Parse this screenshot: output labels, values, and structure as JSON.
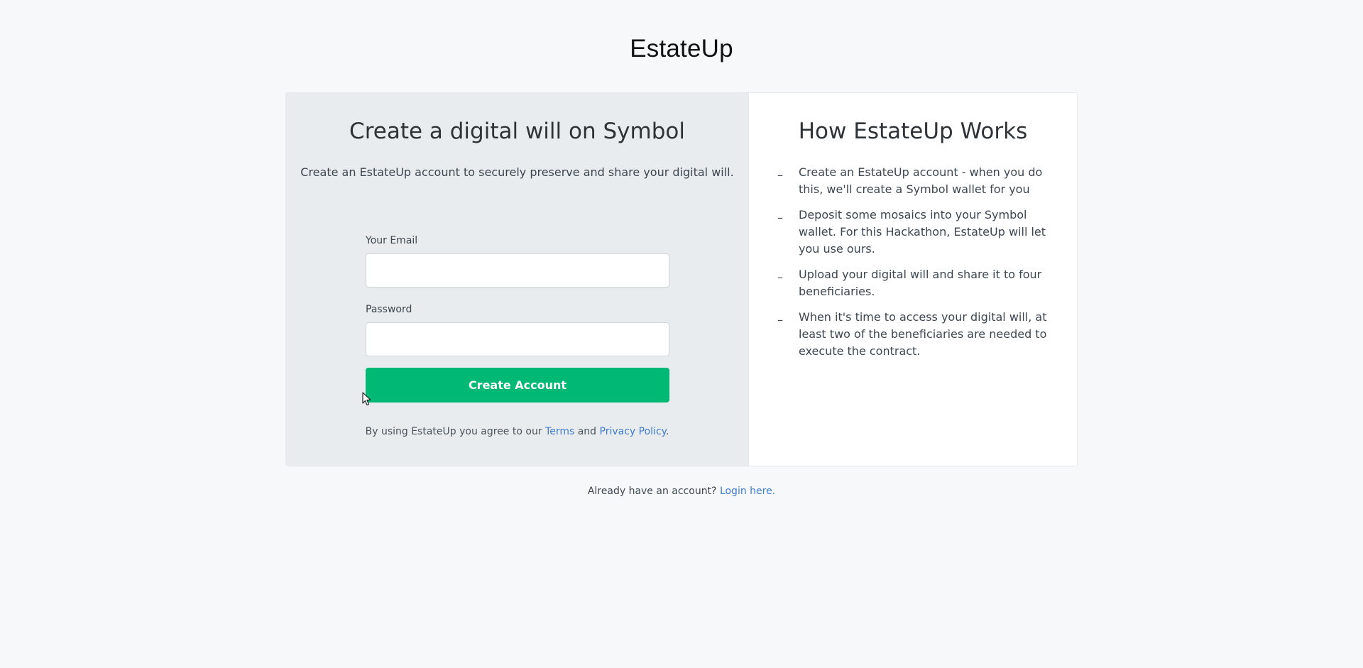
{
  "brand": {
    "name": "EstateUp"
  },
  "signup": {
    "heading": "Create a digital will on Symbol",
    "subheading": "Create an EstateUp account to securely preserve and share your digital will.",
    "email_label": "Your Email",
    "email_value": "",
    "password_label": "Password",
    "password_value": "",
    "submit_label": "Create Account",
    "terms_prefix": "By using EstateUp you agree to our",
    "terms_link": "Terms",
    "terms_and": "and",
    "privacy_link": "Privacy Policy",
    "terms_suffix": "."
  },
  "how_it_works": {
    "heading": "How EstateUp Works",
    "bullet": "–",
    "steps": [
      "Create an EstateUp account - when you do this, we'll create a Symbol wallet for you",
      "Deposit some mosaics into your Symbol wallet. For this Hackathon, EstateUp will let you use ours.",
      "Upload your digital will and share it to four beneficiaries.",
      "When it's time to access your digital will, at least two of the beneficiaries are needed to execute the contract."
    ]
  },
  "footer": {
    "prompt": "Already have an account?",
    "login_link": "Login here."
  },
  "colors": {
    "background": "#f7f8fa",
    "left_panel": "#e9ecef",
    "primary_button": "#02b875",
    "link": "#3f7ccc"
  }
}
